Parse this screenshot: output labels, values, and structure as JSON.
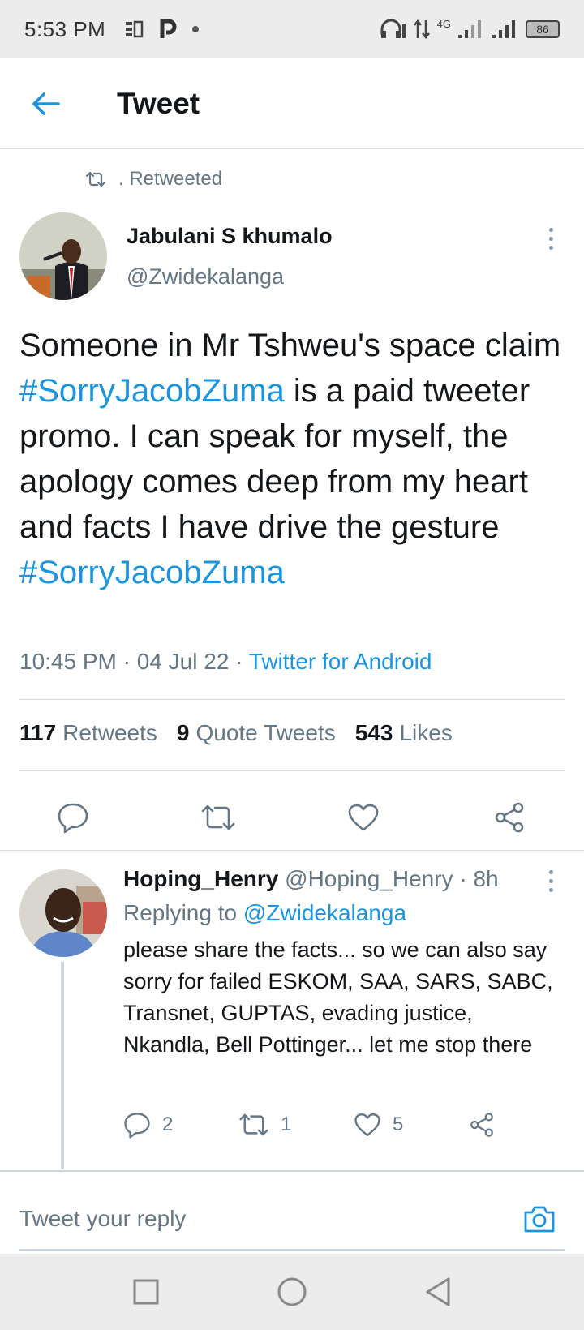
{
  "status_bar": {
    "time": "5:53 PM",
    "network": "4G",
    "battery": "86",
    "icons": [
      "notification-icon",
      "parking-icon",
      "dot-icon",
      "headphones-icon",
      "data-arrows-icon",
      "signal-icon",
      "signal-icon",
      "battery-icon"
    ]
  },
  "header": {
    "title": "Tweet",
    "back_icon": "arrow-left-icon"
  },
  "retweet_banner": {
    "icon": "retweet-icon",
    "text": ". Retweeted"
  },
  "tweet": {
    "author_name": "Jabulani S khumalo",
    "author_handle": "@Zwidekalanga",
    "text_parts": {
      "p1": "Someone in Mr Tshweu's space claim ",
      "hashtag1": "#SorryJacobZuma",
      "p2": " is a paid tweeter promo. I can speak for myself,  the apology comes deep from my heart and facts I have drive the gesture ",
      "hashtag2": "#SorryJacobZuma"
    },
    "time": "10:45 PM",
    "date": "04 Jul 22",
    "separator": " · ",
    "source": "Twitter for Android",
    "stats": {
      "retweets_count": "117",
      "retweets_label": "Retweets",
      "quotes_count": "9",
      "quotes_label": "Quote Tweets",
      "likes_count": "543",
      "likes_label": "Likes"
    },
    "actions": [
      "reply-icon",
      "retweet-icon",
      "like-icon",
      "share-icon"
    ]
  },
  "reply": {
    "name": "Hoping_Henry",
    "handle": "@Hoping_Henry",
    "age": "8h",
    "replying_label": "Replying to ",
    "replying_to": "@Zwidekalanga",
    "text": "please share the facts... so we can also say sorry for failed ESKOM, SAA, SARS, SABC, Transnet, GUPTAS, evading justice, Nkandla, Bell Pottinger... let me stop there",
    "reply_count": "2",
    "retweet_count": "1",
    "like_count": "5"
  },
  "composer": {
    "placeholder": "Tweet your reply",
    "camera_icon": "camera-icon"
  },
  "nav_bar": {
    "icons": [
      "recents-square-icon",
      "home-circle-icon",
      "back-triangle-icon"
    ]
  },
  "colors": {
    "accent": "#1b95e0",
    "secondary_text": "#657786",
    "primary_text": "#14171a",
    "divider": "#d8dde2",
    "system_bar": "#ececec"
  }
}
